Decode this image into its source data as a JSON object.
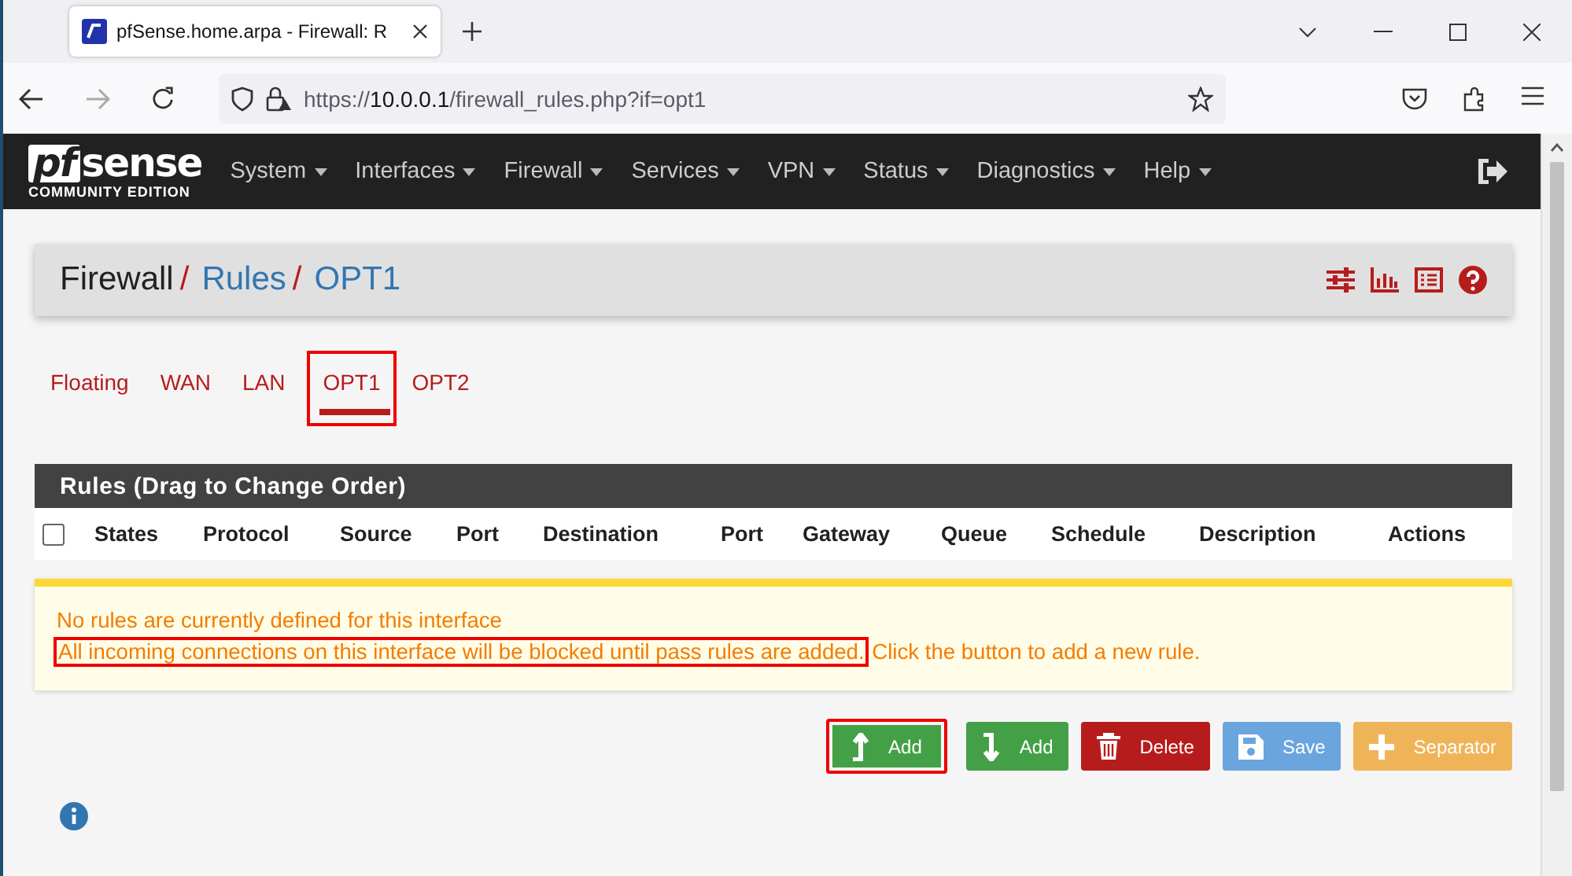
{
  "browser": {
    "tab_title": "pfSense.home.arpa - Firewall: R",
    "url_scheme": "https://",
    "url_host": "10.0.0.1",
    "url_path": "/firewall_rules.php?if=opt1"
  },
  "navbar": {
    "logo": {
      "mark": "pf",
      "word": "sense",
      "tagline": "COMMUNITY EDITION"
    },
    "menu": [
      "System",
      "Interfaces",
      "Firewall",
      "Services",
      "VPN",
      "Status",
      "Diagnostics",
      "Help"
    ]
  },
  "breadcrumb": [
    {
      "label": "Firewall",
      "kind": "plain"
    },
    {
      "label": "Rules",
      "kind": "link",
      "separator_before": "/"
    },
    {
      "label": "OPT1",
      "kind": "link",
      "separator_before": "/"
    }
  ],
  "tabs": [
    {
      "label": "Floating",
      "selected": false,
      "highlighted": false
    },
    {
      "label": "WAN",
      "selected": false,
      "highlighted": false
    },
    {
      "label": "LAN",
      "selected": false,
      "highlighted": false
    },
    {
      "label": "OPT1",
      "selected": true,
      "highlighted": true
    },
    {
      "label": "OPT2",
      "selected": false,
      "highlighted": false
    }
  ],
  "table": {
    "title": "Rules (Drag to Change Order)",
    "select_all_checked": false,
    "columns": [
      "States",
      "Protocol",
      "Source",
      "Port",
      "Destination",
      "Port",
      "Gateway",
      "Queue",
      "Schedule",
      "Description",
      "Actions"
    ]
  },
  "notice": {
    "line_1": "No rules are currently defined for this interface",
    "highlighted_text": "All incoming connections on this interface will be blocked until pass rules are added.",
    "rest_text": "Click the button to add a new rule."
  },
  "buttons": [
    {
      "label": "Add",
      "kind": "add-top",
      "highlighted": true
    },
    {
      "label": "Add",
      "kind": "add-bottom",
      "highlighted": false
    },
    {
      "label": "Delete",
      "kind": "delete",
      "highlighted": false
    },
    {
      "label": "Save",
      "kind": "save",
      "highlighted": false
    },
    {
      "label": "Separator",
      "kind": "separator",
      "highlighted": false
    }
  ]
}
